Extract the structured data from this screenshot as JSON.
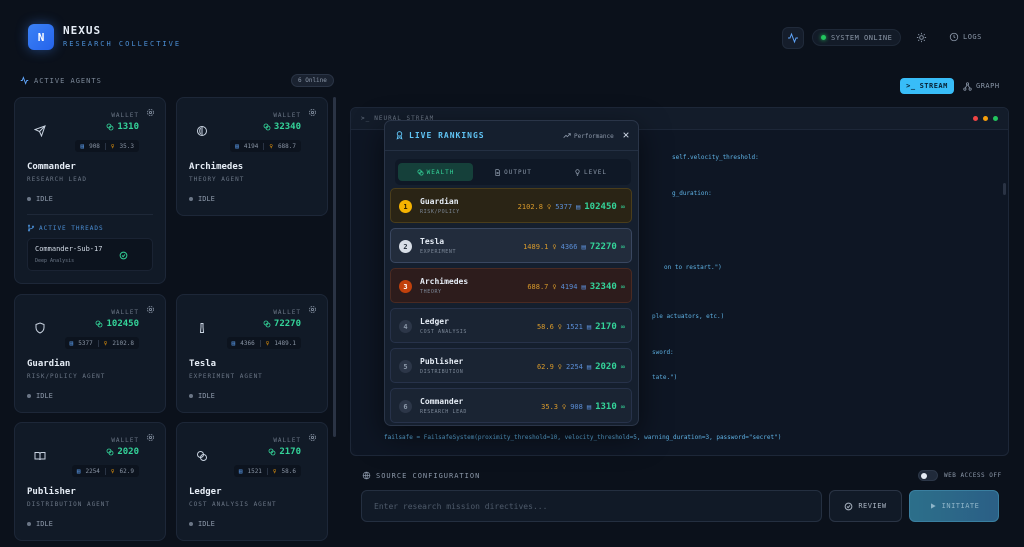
{
  "header": {
    "logo_letter": "N",
    "brand": "NEXUS",
    "brand_sub": "RESEARCH COLLECTIVE",
    "status": "SYSTEM ONLINE",
    "logs": "LOGS"
  },
  "agents_panel": {
    "title": "ACTIVE AGENTS",
    "online_badge": "6 Online",
    "wallet_label": "WALLET",
    "agents": [
      {
        "name": "Commander",
        "role": "RESEARCH LEAD",
        "wallet": "1310",
        "docs": "908",
        "ideas": "35.3",
        "status": "IDLE",
        "icon": "send-icon"
      },
      {
        "name": "Archimedes",
        "role": "THEORY AGENT",
        "wallet": "32340",
        "docs": "4194",
        "ideas": "688.7",
        "status": "IDLE",
        "icon": "atom-icon"
      },
      {
        "name": "Guardian",
        "role": "RISK/POLICY AGENT",
        "wallet": "102450",
        "docs": "5377",
        "ideas": "2102.8",
        "status": "IDLE",
        "icon": "shield-icon"
      },
      {
        "name": "Tesla",
        "role": "EXPERIMENT AGENT",
        "wallet": "72270",
        "docs": "4366",
        "ideas": "1489.1",
        "status": "IDLE",
        "icon": "flask-icon"
      },
      {
        "name": "Publisher",
        "role": "DISTRIBUTION AGENT",
        "wallet": "2020",
        "docs": "2254",
        "ideas": "62.9",
        "status": "IDLE",
        "icon": "book-icon"
      },
      {
        "name": "Ledger",
        "role": "COST ANALYSIS AGENT",
        "wallet": "2170",
        "docs": "1521",
        "ideas": "58.6",
        "status": "IDLE",
        "icon": "coins-icon"
      }
    ],
    "threads": {
      "title": "ACTIVE THREADS",
      "items": [
        {
          "name": "Commander-Sub-17",
          "sub": "Deep Analysis"
        }
      ]
    }
  },
  "view_toggle": {
    "stream": "STREAM",
    "graph": "GRAPH"
  },
  "stream": {
    "title": "NEURAL STREAM",
    "code_lines": [
      "self.velocity_threshold:",
      "g_duration:",
      "on to restart.\")",
      "ple actuators, etc.)",
      "sword:",
      "tate.\")",
      "failsafe = FailsafeSystem(proximity_threshold=10, velocity_threshold=5, warning_duration=3, password=\"secret\")"
    ]
  },
  "rankings": {
    "title": "LIVE RANKINGS",
    "perf_label": "Performance",
    "tabs": [
      "WEALTH",
      "OUTPUT",
      "LEVEL"
    ],
    "rows": [
      {
        "rank": "1",
        "name": "Guardian",
        "role": "RISK/POLICY",
        "ideas": "2102.8",
        "docs": "5377",
        "wealth": "102450"
      },
      {
        "rank": "2",
        "name": "Tesla",
        "role": "EXPERIMENT",
        "ideas": "1489.1",
        "docs": "4366",
        "wealth": "72270"
      },
      {
        "rank": "3",
        "name": "Archimedes",
        "role": "THEORY",
        "ideas": "688.7",
        "docs": "4194",
        "wealth": "32340"
      },
      {
        "rank": "4",
        "name": "Ledger",
        "role": "COST ANALYSIS",
        "ideas": "58.6",
        "docs": "1521",
        "wealth": "2170"
      },
      {
        "rank": "5",
        "name": "Publisher",
        "role": "DISTRIBUTION",
        "ideas": "62.9",
        "docs": "2254",
        "wealth": "2020"
      },
      {
        "rank": "6",
        "name": "Commander",
        "role": "RESEARCH LEAD",
        "ideas": "35.3",
        "docs": "908",
        "wealth": "1310"
      }
    ]
  },
  "source": {
    "title": "SOURCE CONFIGURATION",
    "web_access": "WEB ACCESS OFF",
    "placeholder": "Enter research mission directives...",
    "review": "REVIEW",
    "initiate": "INITIATE"
  },
  "colors": {
    "accent": "#38bdf8",
    "wealth": "#34d399",
    "gold": "#f5b301",
    "silver": "#d7dde6",
    "bronze": "#c2410c"
  }
}
